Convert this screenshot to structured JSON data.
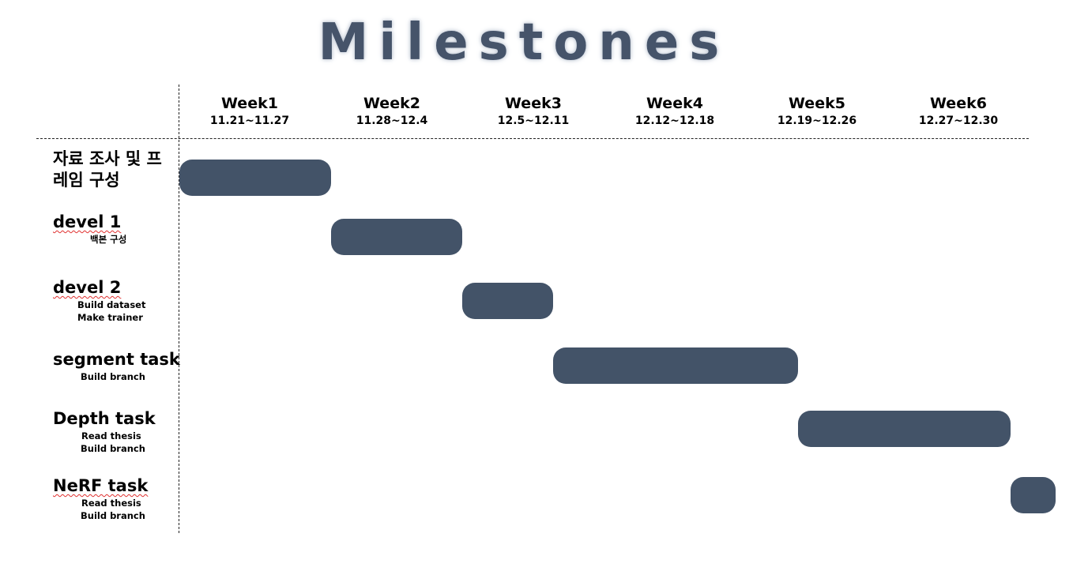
{
  "title": "Milestones",
  "weeks": [
    {
      "name": "Week1",
      "range": "11.21~11.27"
    },
    {
      "name": "Week2",
      "range": "11.28~12.4"
    },
    {
      "name": "Week3",
      "range": "12.5~12.11"
    },
    {
      "name": "Week4",
      "range": "12.12~12.18"
    },
    {
      "name": "Week5",
      "range": "12.19~12.26"
    },
    {
      "name": "Week6",
      "range": "12.27~12.30"
    }
  ],
  "tasks": [
    {
      "line1": "자료 조사 및 프",
      "line2": "레임 구성",
      "start_week": 1.0,
      "end_week": 2.07
    },
    {
      "title": "devel 1",
      "subs": [
        "백본 구성"
      ],
      "start_week": 2.07,
      "end_week": 3.0
    },
    {
      "title": "devel 2",
      "subs": [
        "Build dataset",
        "Make trainer"
      ],
      "start_week": 3.0,
      "end_week": 3.64
    },
    {
      "title": "segment task",
      "subs": [
        "Build branch"
      ],
      "start_week": 3.64,
      "end_week": 5.37
    },
    {
      "title": "Depth task",
      "subs": [
        "Read thesis",
        "Build branch"
      ],
      "start_week": 5.37,
      "end_week": 6.87
    },
    {
      "title": "NeRF task",
      "subs": [
        "Read thesis",
        "Build branch"
      ],
      "start_week": 6.87,
      "end_week": 7.19
    }
  ],
  "colors": {
    "bar": "#435368",
    "title": "#46546a"
  }
}
